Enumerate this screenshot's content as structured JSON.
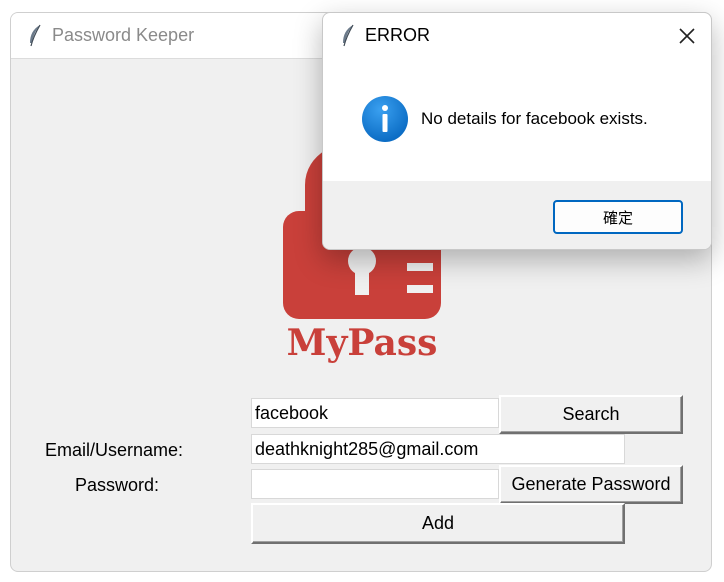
{
  "main_window": {
    "title": "Password Keeper",
    "logo_text": "MyPass",
    "form": {
      "website_value": "facebook",
      "search_label": "Search",
      "email_label": "Email/Username:",
      "email_value": "deathknight285@gmail.com",
      "password_label": "Password:",
      "password_value": "",
      "generate_label": "Generate Password",
      "add_label": "Add"
    }
  },
  "dialog": {
    "title": "ERROR",
    "message": "No details for facebook exists.",
    "ok_label": "確定",
    "icon": "info-icon",
    "close_icon": "close-icon"
  },
  "colors": {
    "logo_red": "#c9403a",
    "info_blue": "#1a7fd6",
    "accent": "#0067c0"
  }
}
